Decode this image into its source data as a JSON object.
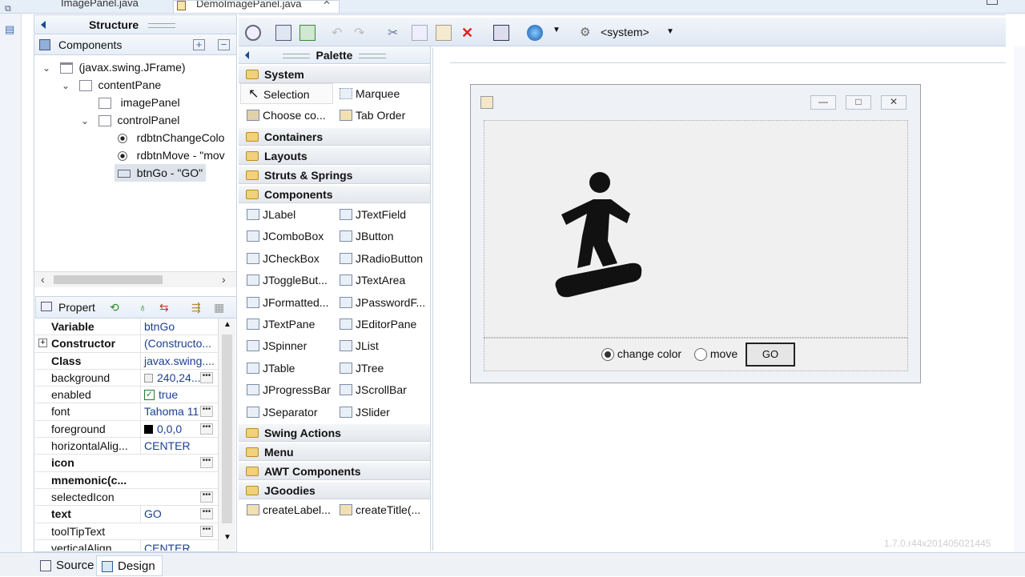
{
  "editor_tabs": [
    {
      "label": "ImagePanel.java"
    },
    {
      "label": "DemoImagePanel.java"
    }
  ],
  "structure": {
    "title": "Structure",
    "components_label": "Components",
    "tree": [
      {
        "label": "(javax.swing.JFrame)"
      },
      {
        "label": "contentPane"
      },
      {
        "label": "imagePanel"
      },
      {
        "label": "controlPanel"
      },
      {
        "label": "rdbtnChangeColo"
      },
      {
        "label": "rdbtnMove - \"mov"
      },
      {
        "label": "btnGo - \"GO\""
      }
    ]
  },
  "properties": {
    "title": "Propert",
    "rows": [
      {
        "name": "Variable",
        "value": "btnGo"
      },
      {
        "name": "Constructor",
        "value": "(Constructo..."
      },
      {
        "name": "Class",
        "value": "javax.swing...."
      },
      {
        "name": "background",
        "value": "240,24..."
      },
      {
        "name": "enabled",
        "value": "true"
      },
      {
        "name": "font",
        "value": "Tahoma 11"
      },
      {
        "name": "foreground",
        "value": "0,0,0"
      },
      {
        "name": "horizontalAlig...",
        "value": "CENTER"
      },
      {
        "name": "icon",
        "value": ""
      },
      {
        "name": "mnemonic(c...",
        "value": ""
      },
      {
        "name": "selectedIcon",
        "value": ""
      },
      {
        "name": "text",
        "value": "GO"
      },
      {
        "name": "toolTipText",
        "value": ""
      },
      {
        "name": "verticalAlign",
        "value": "CENTER"
      }
    ]
  },
  "toolbar": {
    "lookandfeel": "<system>"
  },
  "palette": {
    "title": "Palette",
    "system": {
      "label": "System",
      "items": [
        "Selection",
        "Marquee",
        "Choose co...",
        "Tab Order"
      ]
    },
    "categories": [
      "Containers",
      "Layouts",
      "Struts & Springs"
    ],
    "components": {
      "label": "Components",
      "items": [
        "JLabel",
        "JTextField",
        "JComboBox",
        "JButton",
        "JCheckBox",
        "JRadioButton",
        "JToggleBut...",
        "JTextArea",
        "JFormatted...",
        "JPasswordF...",
        "JTextPane",
        "JEditorPane",
        "JSpinner",
        "JList",
        "JTable",
        "JTree",
        "JProgressBar",
        "JScrollBar",
        "JSeparator",
        "JSlider"
      ]
    },
    "categories2": [
      "Swing Actions",
      "Menu",
      "AWT Components"
    ],
    "jgoodies": {
      "label": "JGoodies",
      "items": [
        "createLabel...",
        "createTitle(..."
      ]
    }
  },
  "form": {
    "radio_change_color": "change color",
    "radio_move": "move",
    "go_button": "GO"
  },
  "version": "1.7.0.r44x201405021445",
  "bottom_tabs": [
    "Source",
    "Design"
  ]
}
